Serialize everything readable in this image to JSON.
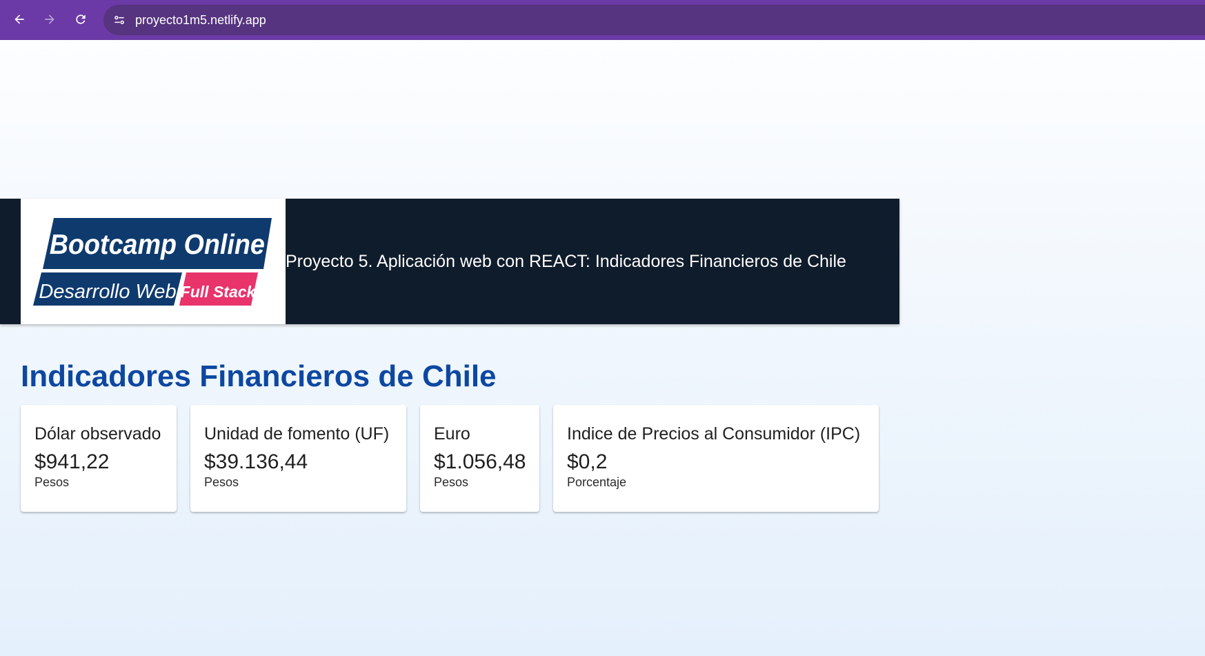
{
  "browser": {
    "url": "proyecto1m5.netlify.app",
    "icons": {
      "back": "arrow-left-icon",
      "forward": "arrow-right-icon",
      "reload": "reload-icon",
      "site_info": "site-settings-icon"
    },
    "colors": {
      "frame": "#6b3aa6",
      "omnibox": "#56347f"
    }
  },
  "header": {
    "logo": {
      "line1": "Bootcamp Online",
      "line2": "Desarrollo Web",
      "line3": "Full Stack",
      "colors": {
        "primary": "#0e3a6e",
        "accent": "#e8336b"
      }
    },
    "title": "Proyecto 5. Aplicación web con REACT: Indicadores Financieros de Chile",
    "background": "#0f1c2b"
  },
  "main": {
    "heading": "Indicadores Financieros de Chile",
    "heading_color": "#0d47a1",
    "indicators": [
      {
        "name": "Dólar observado",
        "value": "$941,22",
        "unit": "Pesos"
      },
      {
        "name": "Unidad de fomento (UF)",
        "value": "$39.136,44",
        "unit": "Pesos"
      },
      {
        "name": "Euro",
        "value": "$1.056,48",
        "unit": "Pesos"
      },
      {
        "name": "Indice de Precios al Consumidor (IPC)",
        "value": "$0,2",
        "unit": "Porcentaje"
      }
    ]
  }
}
